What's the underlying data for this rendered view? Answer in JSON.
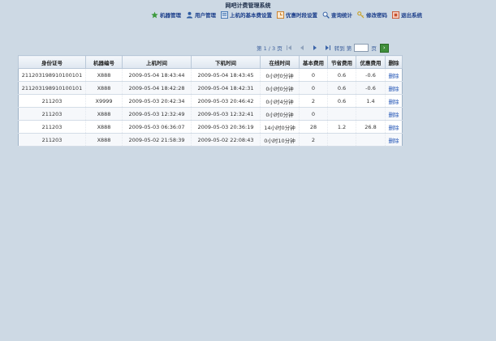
{
  "page_title": "网吧计费管理系统",
  "nav": [
    {
      "label": "机器管理",
      "icon": "star-icon",
      "color": "#3c9a3c"
    },
    {
      "label": "用户管理",
      "icon": "user-icon",
      "color": "#2c5aa0"
    },
    {
      "label": "上机的基本费设置",
      "icon": "settings-icon",
      "color": "#3a6fb0"
    },
    {
      "label": "优惠时段设置",
      "icon": "clock-icon",
      "color": "#c77a22"
    },
    {
      "label": "查询统计",
      "icon": "search-icon",
      "color": "#2c5aa0"
    },
    {
      "label": "修改密码",
      "icon": "key-icon",
      "color": "#c9a227"
    },
    {
      "label": "退出系统",
      "icon": "exit-icon",
      "color": "#c8502d"
    }
  ],
  "pager": {
    "text": "第 1 / 3 页",
    "goto_prefix": "转到 第",
    "goto_suffix": "页",
    "input_value": ""
  },
  "table": {
    "headers": [
      "身份证号",
      "机器编号",
      "上机时间",
      "下机时间",
      "在线时间",
      "基本费用",
      "节省费用",
      "优惠费用",
      "删除"
    ],
    "rows": [
      [
        "211203198910100101",
        "X888",
        "2009-05-04 18:43:44",
        "2009-05-04 18:43:45",
        "0小时0分钟",
        "0",
        "0.6",
        "-0.6",
        "删除"
      ],
      [
        "211203198910100101",
        "X888",
        "2009-05-04 18:42:28",
        "2009-05-04 18:42:31",
        "0小时0分钟",
        "0",
        "0.6",
        "-0.6",
        "删除"
      ],
      [
        "211203",
        "X9999",
        "2009-05-03 20:42:34",
        "2009-05-03 20:46:42",
        "0小时4分钟",
        "2",
        "0.6",
        "1.4",
        "删除"
      ],
      [
        "211203",
        "X888",
        "2009-05-03 12:32:49",
        "2009-05-03 12:32:41",
        "0小时0分钟",
        "0",
        "",
        "",
        "删除"
      ],
      [
        "211203",
        "X888",
        "2009-05-03 06:36:07",
        "2009-05-03 20:36:19",
        "14小时0分钟",
        "28",
        "1.2",
        "26.8",
        "删除"
      ],
      [
        "211203",
        "X888",
        "2009-05-02 21:58:39",
        "2009-05-02 22:08:43",
        "0小时10分钟",
        "2",
        "",
        "",
        "删除"
      ]
    ]
  }
}
